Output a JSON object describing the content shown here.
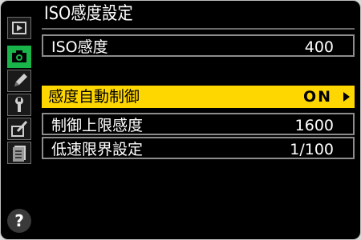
{
  "screen": {
    "title": "ISO感度設定"
  },
  "sidebar": {
    "tabs": [
      {
        "name": "playback",
        "icon": "playback-icon",
        "active": false
      },
      {
        "name": "shooting",
        "icon": "camera-icon",
        "active": true
      },
      {
        "name": "custom",
        "icon": "pencil-icon",
        "active": false
      },
      {
        "name": "setup",
        "icon": "wrench-icon",
        "active": false
      },
      {
        "name": "retouch",
        "icon": "retouch-brush-icon",
        "active": false
      },
      {
        "name": "my-menu",
        "icon": "menu-list-icon",
        "active": false
      }
    ],
    "help_label": "?"
  },
  "settings": {
    "iso": {
      "label": "ISO感度",
      "value": "400"
    },
    "auto": {
      "label": "感度自動制御",
      "value": "ON"
    },
    "max_sensitivity": {
      "label": "制御上限感度",
      "value": "1600"
    },
    "min_shutter": {
      "label": "低速限界設定",
      "value": "1/100"
    }
  },
  "colors": {
    "active_tab": "#19b54a",
    "highlight": "#ffd700",
    "background": "#000000"
  }
}
